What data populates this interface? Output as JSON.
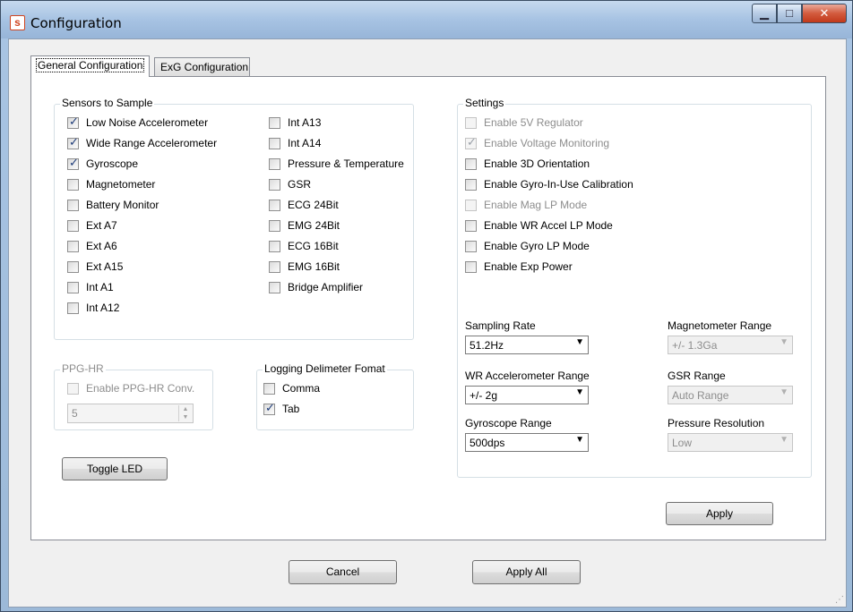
{
  "window": {
    "title": "Configuration",
    "app_icon": "s",
    "minimize_icon": "minimize-icon",
    "maximize_icon": "maximize-icon",
    "close_icon": "close-icon"
  },
  "tabs": [
    {
      "label": "General Configuration",
      "active": true
    },
    {
      "label": "ExG Configuration",
      "active": false
    }
  ],
  "sensors": {
    "title": "Sensors to Sample",
    "col1": [
      {
        "label": "Low Noise Accelerometer",
        "checked": true
      },
      {
        "label": "Wide Range Accelerometer",
        "checked": true
      },
      {
        "label": "Gyroscope",
        "checked": true
      },
      {
        "label": "Magnetometer",
        "checked": false
      },
      {
        "label": "Battery Monitor",
        "checked": false
      },
      {
        "label": "Ext A7",
        "checked": false
      },
      {
        "label": "Ext A6",
        "checked": false
      },
      {
        "label": "Ext A15",
        "checked": false
      },
      {
        "label": "Int A1",
        "checked": false
      },
      {
        "label": "Int A12",
        "checked": false
      }
    ],
    "col2": [
      {
        "label": "Int A13",
        "checked": false
      },
      {
        "label": "Int A14",
        "checked": false
      },
      {
        "label": "Pressure & Temperature",
        "checked": false
      },
      {
        "label": "GSR",
        "checked": false
      },
      {
        "label": "ECG 24Bit",
        "checked": false
      },
      {
        "label": "EMG 24Bit",
        "checked": false
      },
      {
        "label": "ECG 16Bit",
        "checked": false
      },
      {
        "label": "EMG 16Bit",
        "checked": false
      },
      {
        "label": "Bridge Amplifier",
        "checked": false
      }
    ]
  },
  "settings": {
    "title": "Settings",
    "options": [
      {
        "label": "Enable 5V Regulator",
        "checked": false,
        "disabled": true
      },
      {
        "label": "Enable Voltage Monitoring",
        "checked": true,
        "disabled": true
      },
      {
        "label": "Enable 3D Orientation",
        "checked": false,
        "disabled": false
      },
      {
        "label": "Enable Gyro-In-Use Calibration",
        "checked": false,
        "disabled": false
      },
      {
        "label": "Enable Mag LP Mode",
        "checked": false,
        "disabled": true
      },
      {
        "label": "Enable WR Accel LP Mode",
        "checked": false,
        "disabled": false
      },
      {
        "label": "Enable Gyro LP Mode",
        "checked": false,
        "disabled": false
      },
      {
        "label": "Enable Exp Power",
        "checked": false,
        "disabled": false
      }
    ],
    "sampling_rate": {
      "label": "Sampling Rate",
      "value": "51.2Hz"
    },
    "wr_accel_range": {
      "label": "WR Accelerometer Range",
      "value": "+/- 2g"
    },
    "gyro_range": {
      "label": "Gyroscope Range",
      "value": "500dps"
    },
    "mag_range": {
      "label": "Magnetometer Range",
      "value": "+/- 1.3Ga"
    },
    "gsr_range": {
      "label": "GSR Range",
      "value": "Auto Range"
    },
    "pressure_res": {
      "label": "Pressure Resolution",
      "value": "Low"
    },
    "apply_label": "Apply"
  },
  "ppg": {
    "title": "PPG-HR",
    "enable_label": "Enable PPG-HR Conv.",
    "enable_checked": false,
    "value": "5"
  },
  "logging": {
    "title": "Logging Delimeter Fomat",
    "comma_label": "Comma",
    "comma_checked": false,
    "tab_label": "Tab",
    "tab_checked": true
  },
  "toggle_led_label": "Toggle LED",
  "footer": {
    "cancel_label": "Cancel",
    "apply_all_label": "Apply All"
  }
}
